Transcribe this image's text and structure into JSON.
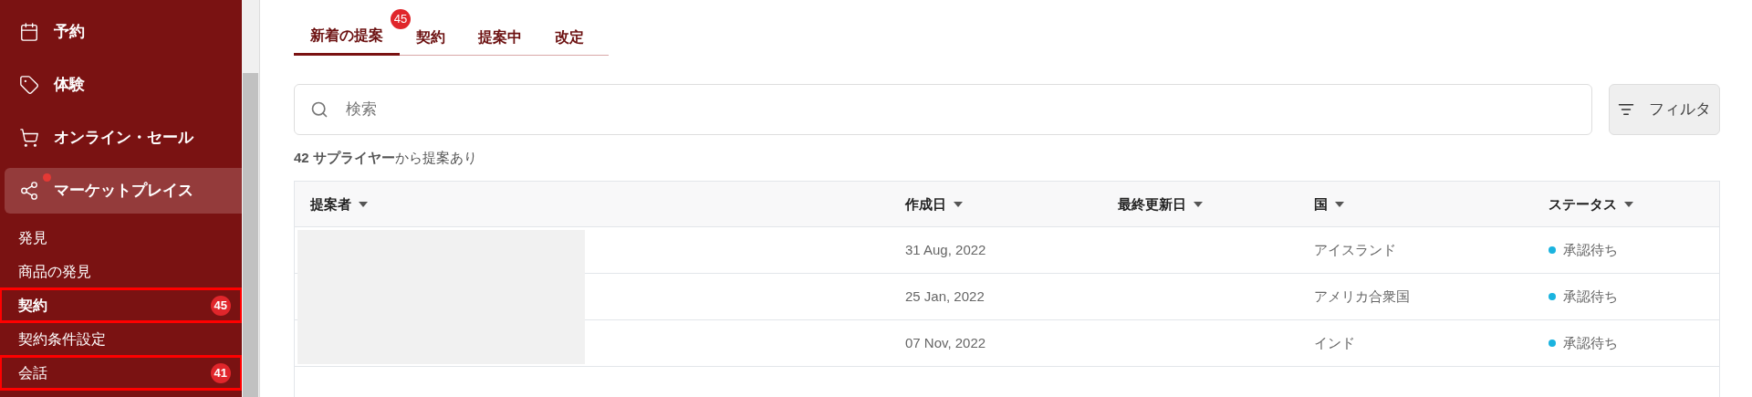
{
  "sidebar": {
    "items": [
      {
        "label": "予約",
        "selected": false,
        "dot": false
      },
      {
        "label": "体験",
        "selected": false,
        "dot": false
      },
      {
        "label": "オンライン・セール",
        "selected": false,
        "dot": false
      },
      {
        "label": "マーケットプレイス",
        "selected": true,
        "dot": true
      }
    ],
    "subitems": [
      {
        "label": "発見",
        "selected": false,
        "highlighted": false
      },
      {
        "label": "商品の発見",
        "selected": false,
        "highlighted": false
      },
      {
        "label": "契約",
        "selected": true,
        "highlighted": true,
        "badge": "45"
      },
      {
        "label": "契約条件設定",
        "selected": false,
        "highlighted": false
      },
      {
        "label": "会話",
        "selected": false,
        "highlighted": true,
        "badge": "41"
      }
    ]
  },
  "tabs": [
    {
      "label": "新着の提案",
      "selected": true,
      "badge": "45"
    },
    {
      "label": "契約",
      "selected": false
    },
    {
      "label": "提案中",
      "selected": false
    },
    {
      "label": "改定",
      "selected": false
    }
  ],
  "search": {
    "placeholder": "検索"
  },
  "filter_button": "フィルタ",
  "summary": "**42 サプライヤー**から提案あり",
  "table": {
    "columns": [
      "提案者",
      "作成日",
      "最終更新日",
      "国",
      "ステータス"
    ],
    "rows": [
      {
        "created": "31 Aug, 2022",
        "country": "アイスランド",
        "status": "承認待ち",
        "color": "#1ab3df"
      },
      {
        "created": "25 Jan, 2022",
        "country": "アメリカ合衆国",
        "status": "承認待ち",
        "color": "#1ab3df"
      },
      {
        "created": "07 Nov, 2022",
        "country": "インド",
        "status": "承認待ち",
        "color": "#1ab3df"
      }
    ]
  }
}
